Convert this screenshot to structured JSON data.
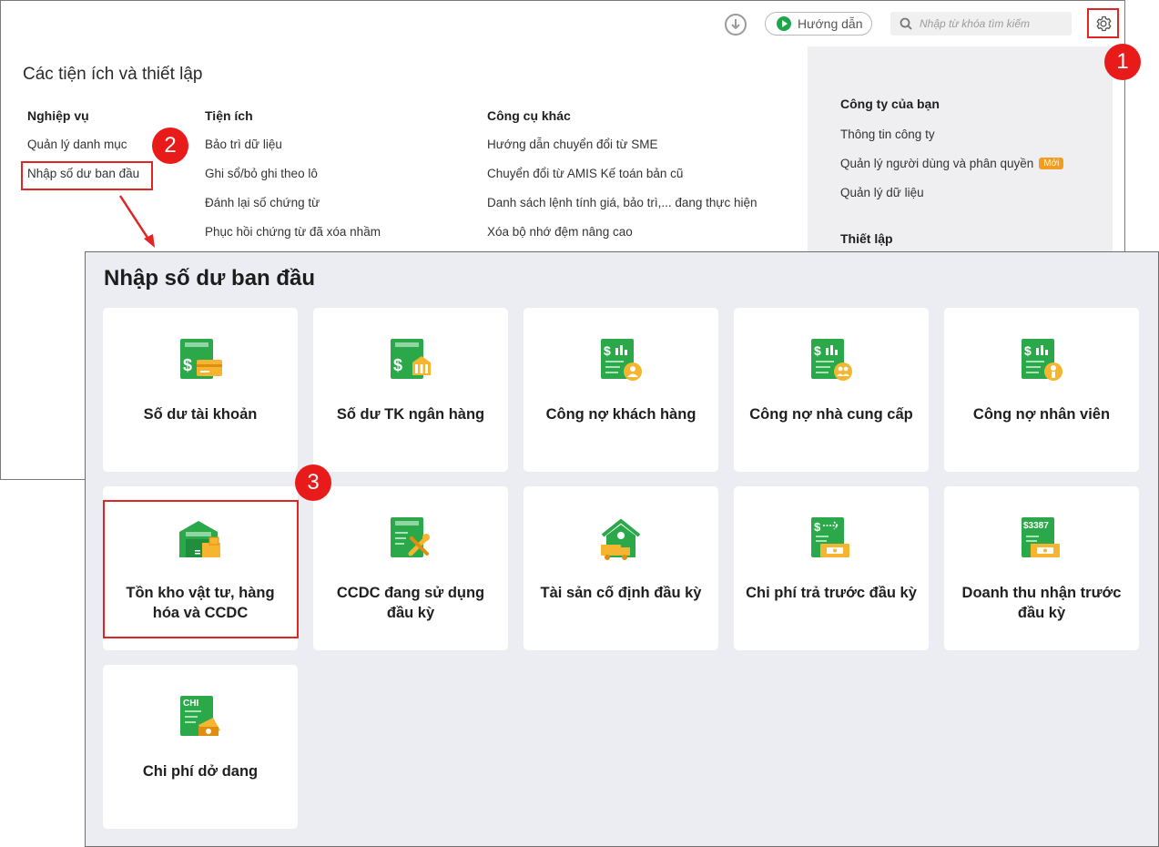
{
  "topbar": {
    "guide_label": "Hướng dẫn",
    "search_placeholder": "Nhập từ khóa tìm kiếm"
  },
  "settings": {
    "title": "Các tiện ích và thiết lập",
    "columns": [
      {
        "title": "Nghiệp vụ",
        "items": [
          "Quản lý danh mục",
          "Nhập số dư ban đầu"
        ]
      },
      {
        "title": "Tiện ích",
        "items": [
          "Bảo trì dữ liệu",
          "Ghi sổ/bỏ ghi theo lô",
          "Đánh lại số chứng từ",
          "Phục hồi chứng từ đã xóa nhầm"
        ]
      },
      {
        "title": "Công cụ khác",
        "items": [
          "Hướng dẫn chuyển đổi từ SME",
          "Chuyển đổi từ AMIS Kế toán bản cũ",
          "Danh sách lệnh tính giá, bảo trì,... đang thực hiện",
          "Xóa bộ nhớ đệm nâng cao"
        ]
      }
    ],
    "right_panel": {
      "company_title": "Công ty của bạn",
      "company_items": [
        "Thông tin công ty",
        "Quản lý người dùng và phân quyền",
        "Quản lý dữ liệu"
      ],
      "new_badge": "Mới",
      "setup_title": "Thiết lập"
    }
  },
  "steps": [
    "1",
    "2",
    "3"
  ],
  "panel": {
    "title": "Nhập số dư ban đầu",
    "cards": [
      {
        "label": "Số dư tài khoản",
        "icon": "account-balance-icon"
      },
      {
        "label": "Số dư TK ngân hàng",
        "icon": "bank-balance-icon"
      },
      {
        "label": "Công nợ khách hàng",
        "icon": "customer-debt-icon"
      },
      {
        "label": "Công nợ nhà cung cấp",
        "icon": "supplier-debt-icon"
      },
      {
        "label": "Công nợ nhân viên",
        "icon": "employee-debt-icon"
      },
      {
        "label": "Tồn kho vật tư, hàng hóa và CCDC",
        "icon": "warehouse-icon"
      },
      {
        "label": "CCDC đang sử dụng đầu kỳ",
        "icon": "tools-icon"
      },
      {
        "label": "Tài sản cố định đầu kỳ",
        "icon": "fixed-asset-icon"
      },
      {
        "label": "Chi phí trả trước đầu kỳ",
        "icon": "prepaid-expense-icon"
      },
      {
        "label": "Doanh thu nhận trước đầu kỳ",
        "icon": "prepaid-revenue-icon"
      },
      {
        "label": "Chi phí dở dang",
        "icon": "wip-cost-icon"
      }
    ],
    "doc_texts": {
      "chi": "CHI",
      "amount": "$3387"
    }
  },
  "colors": {
    "accent_green": "#2aa84a",
    "highlight_red": "#e12424",
    "badge_orange": "#f39c22"
  }
}
